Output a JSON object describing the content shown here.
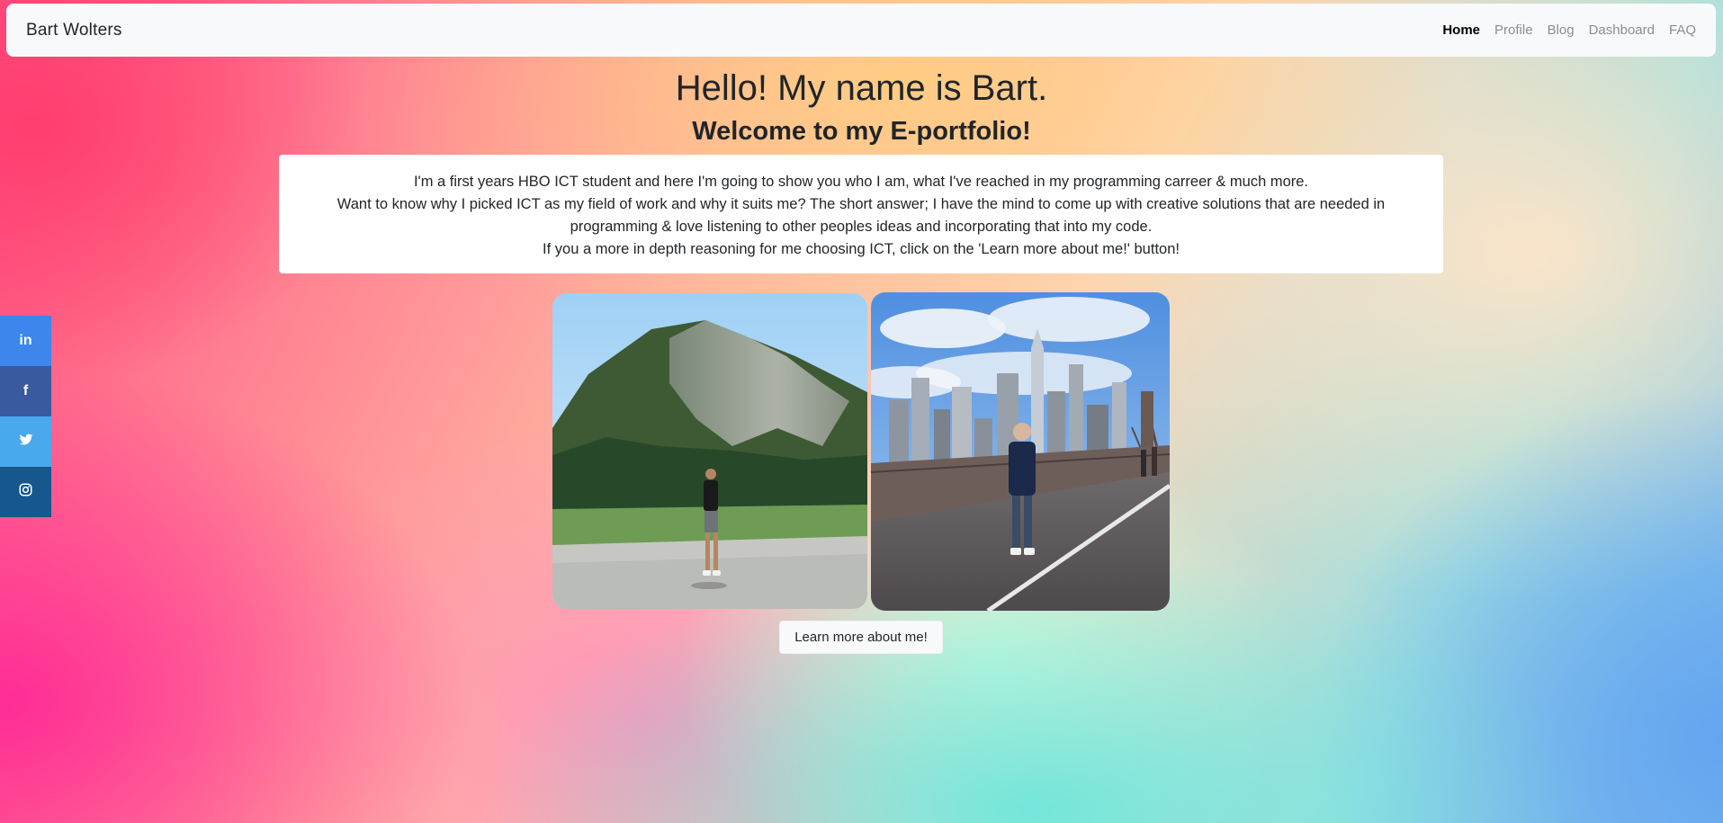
{
  "navbar": {
    "brand": "Bart Wolters",
    "links": [
      {
        "label": "Home",
        "active": true
      },
      {
        "label": "Profile",
        "active": false
      },
      {
        "label": "Blog",
        "active": false
      },
      {
        "label": "Dashboard",
        "active": false
      },
      {
        "label": "FAQ",
        "active": false
      }
    ]
  },
  "hero": {
    "title": "Hello! My name is Bart.",
    "subtitle": "Welcome to my E-portfolio!"
  },
  "intro": {
    "line1": "I'm a first years HBO ICT student and here I'm going to show you who I am, what I've reached in my programming carreer & much more.",
    "line2": "Want to know why I picked ICT as my field of work and why it suits me? The short answer; I have the mind to come up with creative solutions that are needed in programming & love listening to other peoples ideas and incorporating that into my code.",
    "line3": "If you a more in depth reasoning for me choosing ICT, click on the 'Learn more about me!' button!"
  },
  "photos": [
    {
      "icon": "mountain-photo"
    },
    {
      "icon": "city-bridge-photo"
    }
  ],
  "cta": {
    "label": "Learn more about me!"
  },
  "social": [
    {
      "icon": "linkedin-icon",
      "glyph": "in",
      "color": "#3c86ec"
    },
    {
      "icon": "facebook-icon",
      "glyph": "f",
      "color": "#3a5aa0"
    },
    {
      "icon": "twitter-icon",
      "glyph": "bird",
      "color": "#4aa8ec"
    },
    {
      "icon": "instagram-icon",
      "glyph": "camera",
      "color": "#16578e"
    }
  ]
}
